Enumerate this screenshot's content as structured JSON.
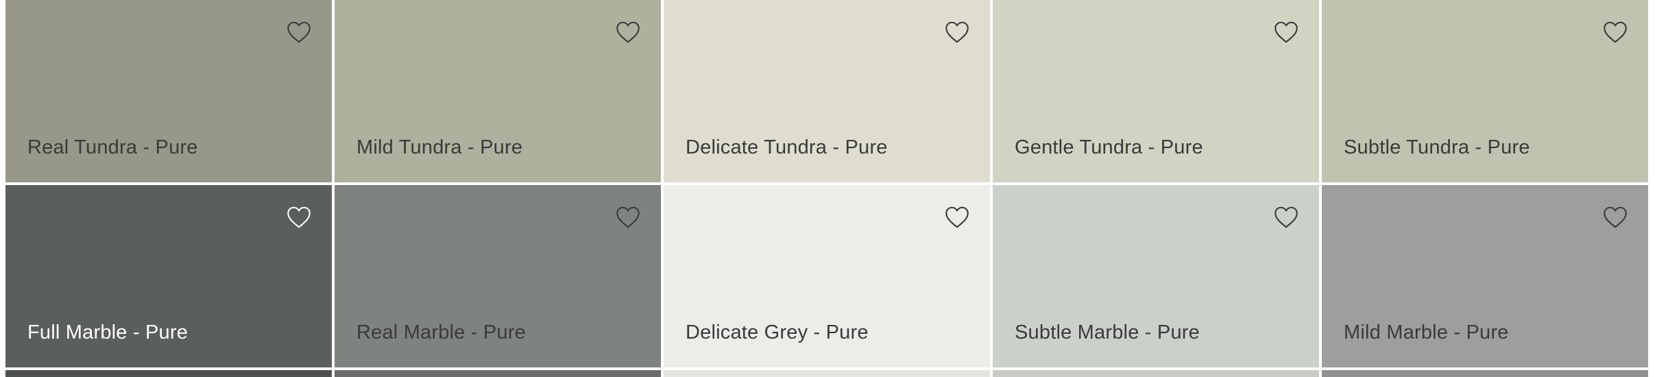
{
  "swatches": [
    {
      "label": "Real Tundra - Pure",
      "color": "#97978a",
      "text_color": "#3a3a3a",
      "icon": "heart-outline-icon"
    },
    {
      "label": "Mild Tundra - Pure",
      "color": "#b0b09f",
      "text_color": "#3a3a3a",
      "icon": "heart-outline-icon"
    },
    {
      "label": "Delicate Tundra - Pure",
      "color": "#dfddd0",
      "text_color": "#3a3a3a",
      "icon": "heart-outline-icon"
    },
    {
      "label": "Gentle Tundra - Pure",
      "color": "#d0d4c3",
      "text_color": "#3a3a3a",
      "icon": "heart-outline-icon"
    },
    {
      "label": "Subtle Tundra - Pure",
      "color": "#c1c2af",
      "text_color": "#3a3a3a",
      "icon": "heart-outline-icon"
    },
    {
      "label": "Full Marble - Pure",
      "color": "#5a5f5e",
      "text_color": "#ffffff",
      "icon": "heart-outline-icon"
    },
    {
      "label": "Real Marble - Pure",
      "color": "#7e8380",
      "text_color": "#3a3a3a",
      "icon": "heart-outline-icon"
    },
    {
      "label": "Delicate Grey - Pure",
      "color": "#ecece8",
      "text_color": "#3a3a3a",
      "icon": "heart-outline-icon"
    },
    {
      "label": "Subtle Marble - Pure",
      "color": "#cbd0cb",
      "text_color": "#3a3a3a",
      "icon": "heart-outline-icon"
    },
    {
      "label": "Mild Marble - Pure",
      "color": "#9c9f9e",
      "text_color": "#3a3a3a",
      "icon": "heart-outline-icon"
    }
  ],
  "partial_row_colors": [
    "#4d5150",
    "#6a6d6b",
    "#e6e5df",
    "#c8cbc4",
    "#8e918f"
  ]
}
